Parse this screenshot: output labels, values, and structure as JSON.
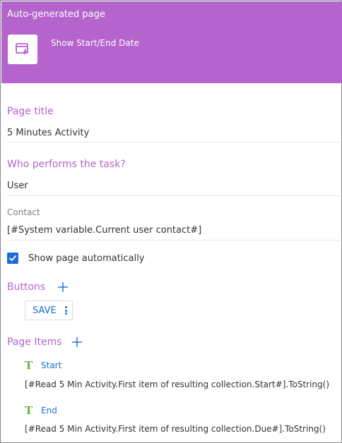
{
  "header": {
    "title": "Auto-generated page",
    "action_label": "Show Start/End Date",
    "tile_icon": "page-lightning-icon",
    "background_color": "#b464cc"
  },
  "page_title": {
    "label": "Page title",
    "value": "5 Minutes Activity"
  },
  "performer": {
    "label": "Who performs the task?",
    "value": "User"
  },
  "contact": {
    "label": "Contact",
    "value": "[#System variable.Current user contact#]"
  },
  "show_page": {
    "label": "Show page automatically",
    "checked": true
  },
  "buttons": {
    "label": "Buttons",
    "items": [
      {
        "label": "SAVE"
      }
    ]
  },
  "page_items": {
    "label": "Page Items",
    "items": [
      {
        "name": "Start",
        "value": "[#Read 5 Min Activity.First item of resulting collection.Start#].ToString()"
      },
      {
        "name": "End",
        "value": "[#Read 5 Min Activity.First item of resulting collection.Due#].ToString()"
      }
    ]
  },
  "colors": {
    "accent": "#b464cc",
    "link": "#1f6cd4",
    "text_icon": "#64b43c"
  }
}
